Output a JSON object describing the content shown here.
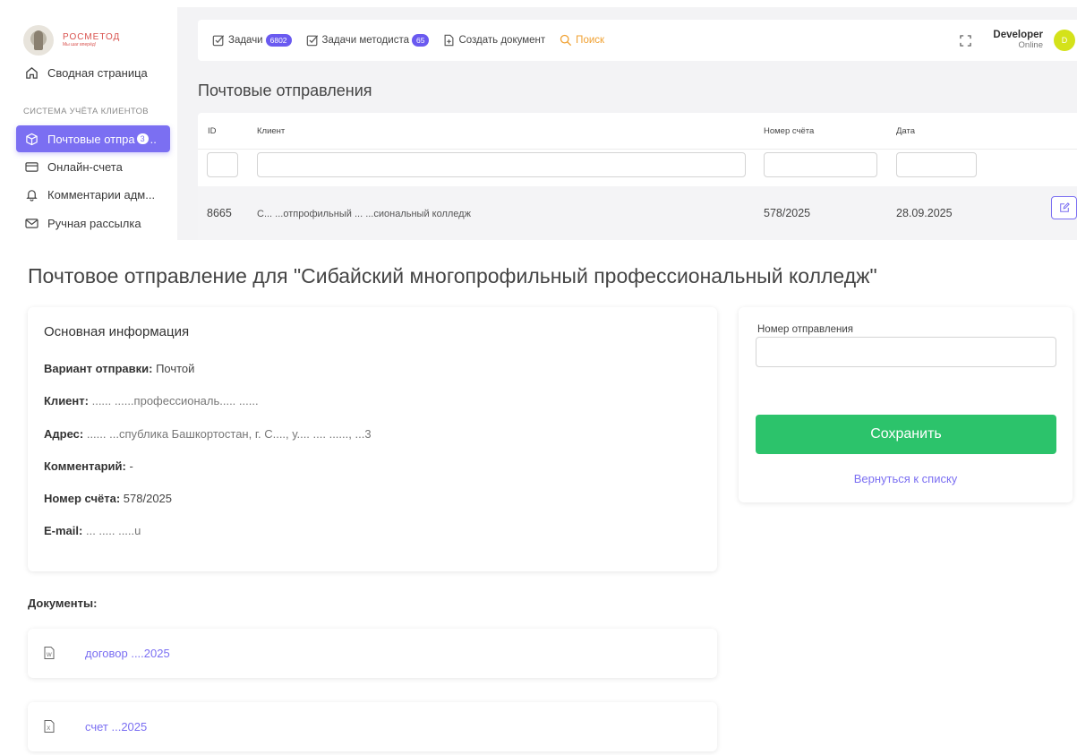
{
  "sidebar": {
    "logo": {
      "title": "РОСМЕТОД",
      "subtitle": "Мы шаг вперёд!"
    },
    "items": [
      {
        "label": "Сводная страница",
        "icon": "home-icon"
      },
      {
        "label": "Почтовые отпра",
        "badge": "3",
        "suffix": "..",
        "icon": "box-icon",
        "active": true
      },
      {
        "label": "Онлайн-счета",
        "icon": "card-icon"
      },
      {
        "label": "Комментарии адм...",
        "icon": "bell-icon"
      },
      {
        "label": "Ручная рассылка",
        "icon": "mail-icon"
      }
    ],
    "section_label": "СИСТЕМА УЧЁТА КЛИЕНТОВ"
  },
  "topbar": {
    "tasks_label": "Задачи",
    "tasks_count": "6802",
    "methodist_label": "Задачи методиста",
    "methodist_count": "65",
    "create_doc_label": "Создать документ",
    "search_label": "Поиск",
    "user_name": "Developer",
    "user_status": "Online",
    "avatar_letter": "D"
  },
  "list_page": {
    "title": "Почтовые отправления",
    "columns": [
      "ID",
      "Клиент",
      "Номер счёта",
      "Дата"
    ],
    "row": {
      "id": "8665",
      "client": "С... ...отпрофильный ... ...сиональный колледж",
      "invoice": "578/2025",
      "date": "28.09.2025"
    }
  },
  "detail": {
    "title": "Почтовое отправление для \"Сибайский многопрофильный профессиональный колледж\"",
    "info_heading": "Основная информация",
    "fields": [
      {
        "key": "Вариант отправки:",
        "value": "Почтой"
      },
      {
        "key": "Клиент:",
        "value": "...... ......профессиональ..... ......"
      },
      {
        "key": "Адрес:",
        "value": "...... ...спублика Башкортостан, г. С...., у.... .... ......, ...3"
      },
      {
        "key": "Комментарий:",
        "value": "-"
      },
      {
        "key": "Номер счёта:",
        "value": "578/2025"
      },
      {
        "key": "E-mail:",
        "value": "... .....  .....u"
      }
    ],
    "side": {
      "tracking_label": "Номер отправления",
      "tracking_value": "",
      "save_label": "Сохранить",
      "back_label": "Вернуться к списку"
    },
    "docs_heading": "Документы:",
    "documents": [
      {
        "label": "договор ....2025",
        "icon": "word-file-icon"
      },
      {
        "label": "счет ...2025",
        "icon": "excel-file-icon"
      }
    ]
  },
  "colors": {
    "accent": "#7b6ff2",
    "save_green": "#2cc36b",
    "search_orange": "#f0a030",
    "avatar": "#d4e21a",
    "logo_red": "#d9534f"
  }
}
